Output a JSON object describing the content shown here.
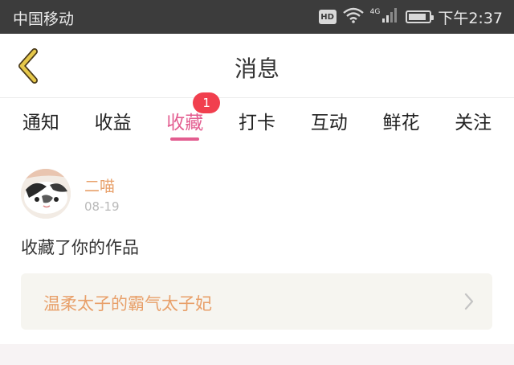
{
  "status_bar": {
    "carrier": "中国移动",
    "hd_label": "HD",
    "network": "4G",
    "battery_level": 0.85,
    "time": "下午2:37",
    "icons": [
      "hd-icon",
      "wifi-icon",
      "signal-icon",
      "battery-icon"
    ]
  },
  "header": {
    "back_icon": "chevron-left-icon",
    "title": "消息"
  },
  "tabs": [
    {
      "label": "通知",
      "active": false
    },
    {
      "label": "收益",
      "active": false
    },
    {
      "label": "收藏",
      "active": true,
      "badge": "1"
    },
    {
      "label": "打卡",
      "active": false
    },
    {
      "label": "互动",
      "active": false
    },
    {
      "label": "鲜花",
      "active": false
    },
    {
      "label": "关注",
      "active": false
    }
  ],
  "message": {
    "user_name": "二喵",
    "date": "08-19",
    "action_text": "收藏了你的作品",
    "work_title": "温柔太子的霸气太子妃",
    "arrow_icon": "chevron-right-icon"
  },
  "colors": {
    "accent": "#e35d90",
    "badge": "#f13f4e",
    "name": "#e8a06a",
    "status_bar": "#3c3c3c",
    "back_icon": "#e6c84a",
    "card_bg": "#f6f5f0"
  }
}
